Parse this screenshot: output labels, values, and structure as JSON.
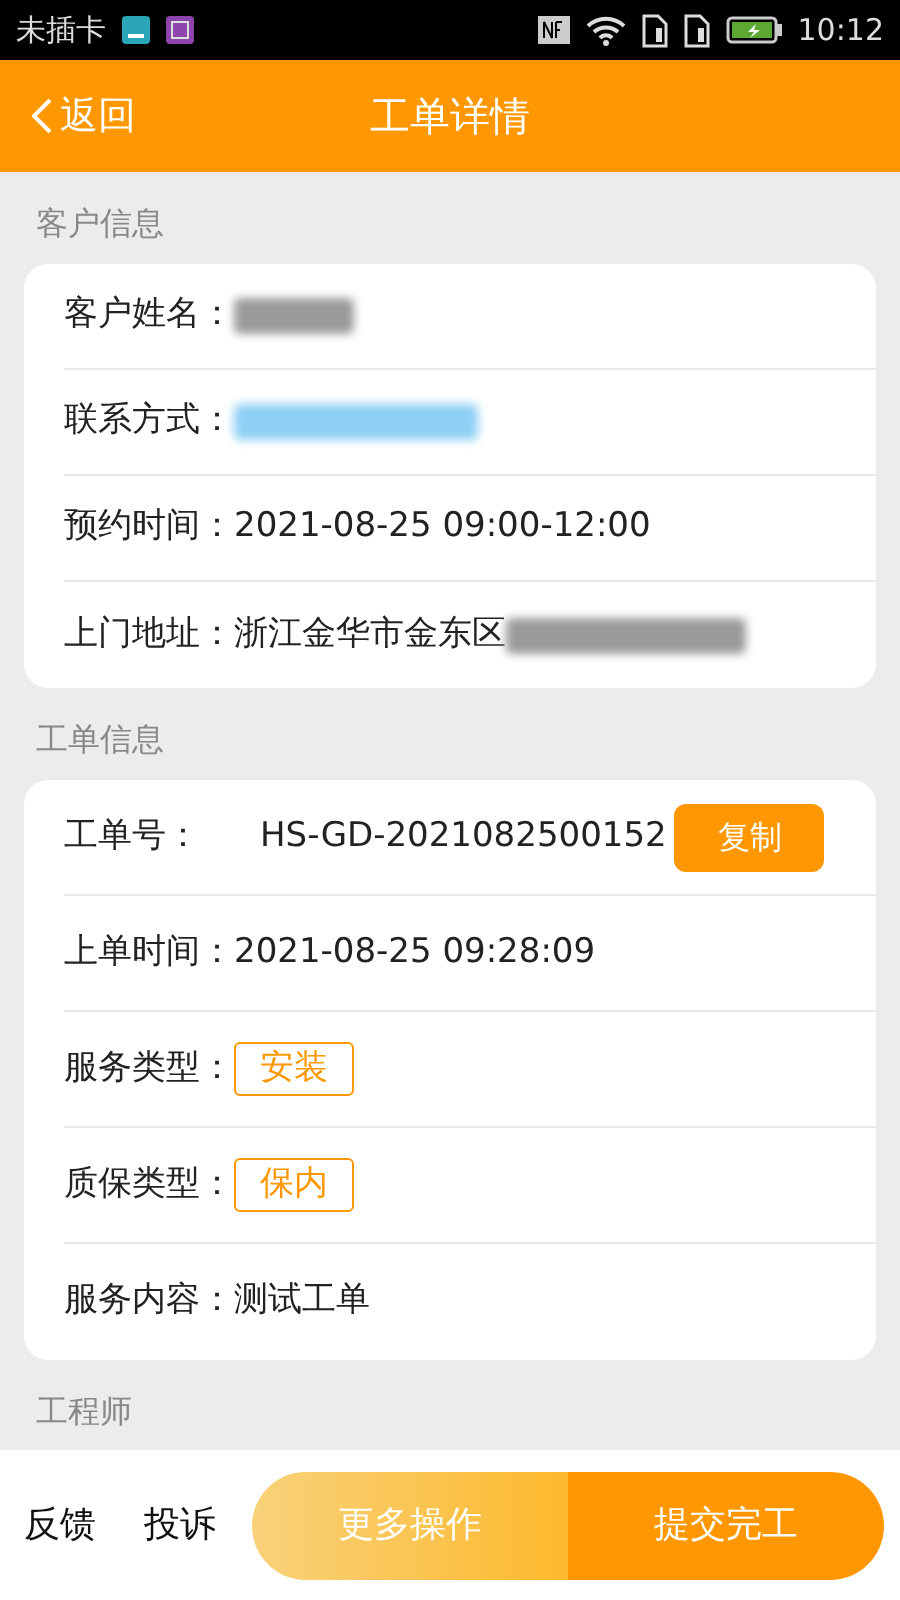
{
  "status_bar": {
    "carrier": "未插卡",
    "time": "10:12"
  },
  "header": {
    "back": "返回",
    "title": "工单详情"
  },
  "sections": [
    {
      "title": "客户信息",
      "rows": [
        {
          "kind": "text",
          "label": "客户姓名：",
          "blurred": true
        },
        {
          "kind": "link",
          "label": "联系方式：",
          "blurred": true
        },
        {
          "kind": "text",
          "label": "预约时间：",
          "value": "2021-08-25 09:00-12:00"
        },
        {
          "kind": "text",
          "label": "上门地址：",
          "value": "浙江金华市金东区",
          "blurred": true
        }
      ]
    },
    {
      "title": "工单信息",
      "rows": [
        {
          "kind": "copy",
          "label": "工单号：",
          "value": "HS-GD-2021082500152",
          "button": "复制"
        },
        {
          "kind": "text",
          "label": "上单时间：",
          "value": "2021-08-25 09:28:09"
        },
        {
          "kind": "tag",
          "label": "服务类型：",
          "value": "安装"
        },
        {
          "kind": "tag",
          "label": "质保类型：",
          "value": "保内"
        },
        {
          "kind": "text",
          "label": "服务内容：",
          "value": "测试工单"
        }
      ]
    },
    {
      "title": "工程师"
    }
  ],
  "bottom_bar": {
    "links": [
      "反馈",
      "投诉"
    ],
    "more": "更多操作",
    "submit": "提交完工"
  }
}
